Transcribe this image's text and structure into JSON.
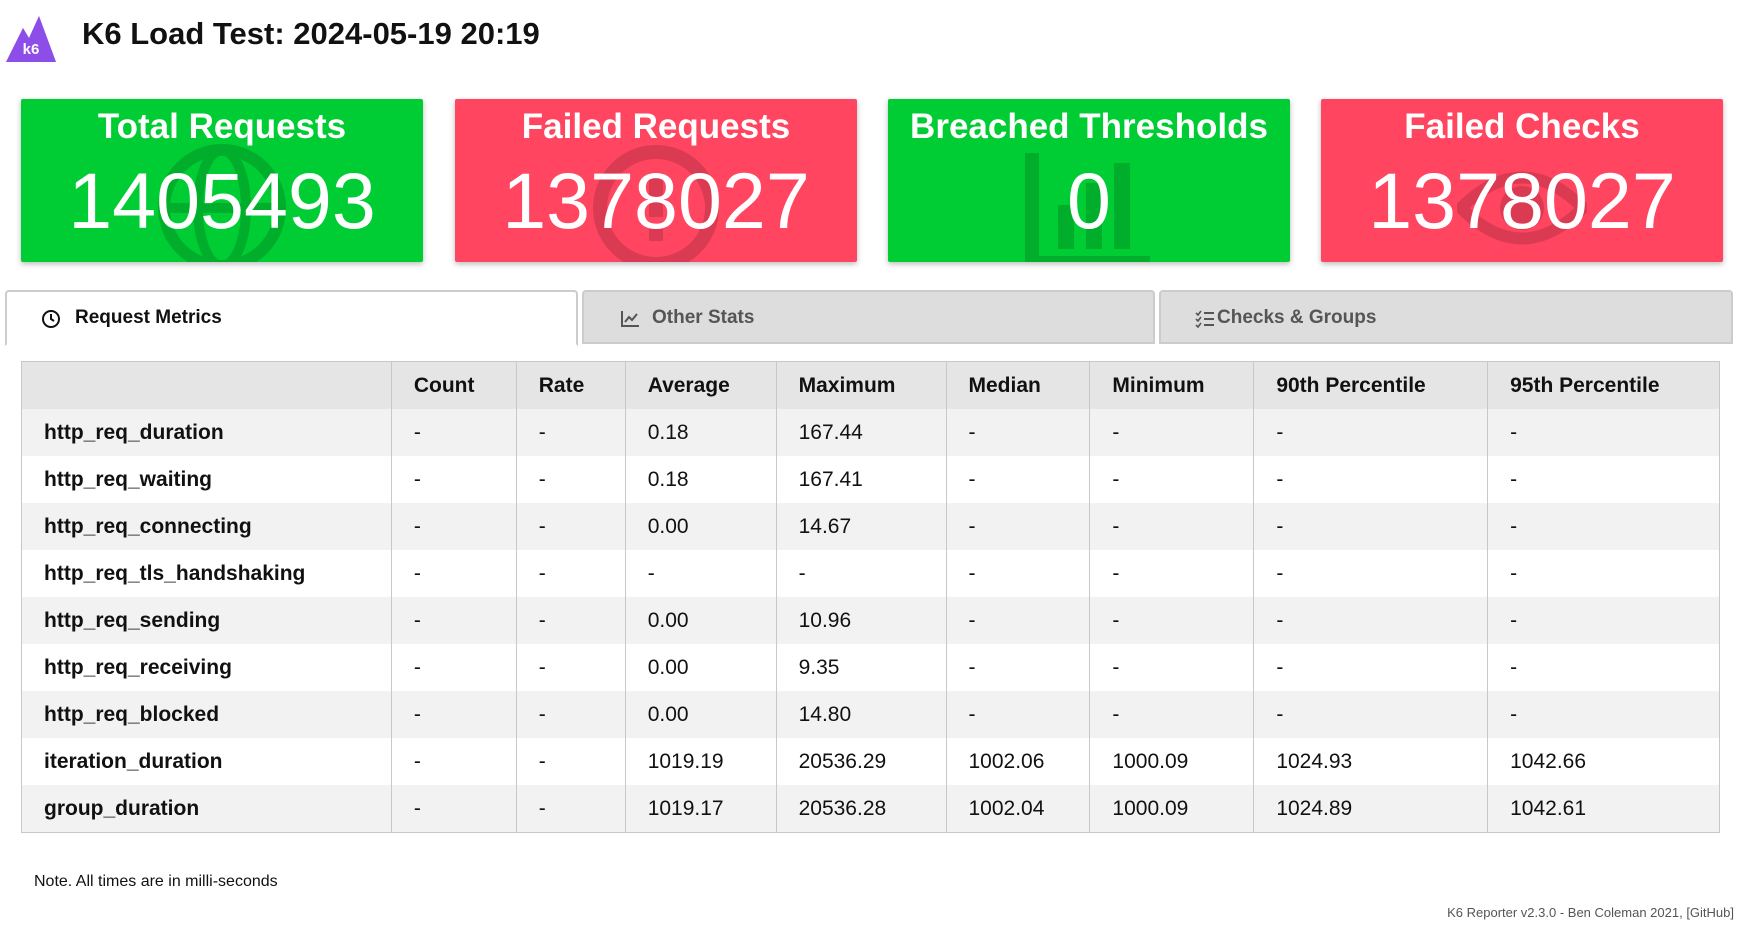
{
  "header": {
    "logo_text": "k6",
    "title": "K6 Load Test: 2024-05-19 20:19"
  },
  "cards": [
    {
      "title": "Total Requests",
      "value": "1405493",
      "status": "green",
      "icon": "globe-icon"
    },
    {
      "title": "Failed Requests",
      "value": "1378027",
      "status": "red",
      "icon": "warning-icon"
    },
    {
      "title": "Breached Thresholds",
      "value": "0",
      "status": "green",
      "icon": "chart-bar-icon"
    },
    {
      "title": "Failed Checks",
      "value": "1378027",
      "status": "red",
      "icon": "eye-icon"
    }
  ],
  "colors": {
    "green": "#00cc33",
    "red": "#ff4560"
  },
  "tabs": [
    {
      "label": "Request Metrics",
      "icon": "clock-icon",
      "active": true
    },
    {
      "label": "Other Stats",
      "icon": "chart-line-icon",
      "active": false
    },
    {
      "label": "Checks & Groups",
      "icon": "list-check-icon",
      "active": false
    }
  ],
  "table": {
    "headers": [
      "",
      "Count",
      "Rate",
      "Average",
      "Maximum",
      "Median",
      "Minimum",
      "90th Percentile",
      "95th Percentile"
    ],
    "rows": [
      [
        "http_req_duration",
        "-",
        "-",
        "0.18",
        "167.44",
        "-",
        "-",
        "-",
        "-"
      ],
      [
        "http_req_waiting",
        "-",
        "-",
        "0.18",
        "167.41",
        "-",
        "-",
        "-",
        "-"
      ],
      [
        "http_req_connecting",
        "-",
        "-",
        "0.00",
        "14.67",
        "-",
        "-",
        "-",
        "-"
      ],
      [
        "http_req_tls_handshaking",
        "-",
        "-",
        "-",
        "-",
        "-",
        "-",
        "-",
        "-"
      ],
      [
        "http_req_sending",
        "-",
        "-",
        "0.00",
        "10.96",
        "-",
        "-",
        "-",
        "-"
      ],
      [
        "http_req_receiving",
        "-",
        "-",
        "0.00",
        "9.35",
        "-",
        "-",
        "-",
        "-"
      ],
      [
        "http_req_blocked",
        "-",
        "-",
        "0.00",
        "14.80",
        "-",
        "-",
        "-",
        "-"
      ],
      [
        "iteration_duration",
        "-",
        "-",
        "1019.19",
        "20536.29",
        "1002.06",
        "1000.09",
        "1024.93",
        "1042.66"
      ],
      [
        "group_duration",
        "-",
        "-",
        "1019.17",
        "20536.28",
        "1002.04",
        "1000.09",
        "1024.89",
        "1042.61"
      ]
    ]
  },
  "note": "Note. All times are in milli-seconds",
  "footer": {
    "text": "K6 Reporter v2.3.0 - Ben Coleman 2021, ",
    "link_label": "[GitHub]"
  }
}
